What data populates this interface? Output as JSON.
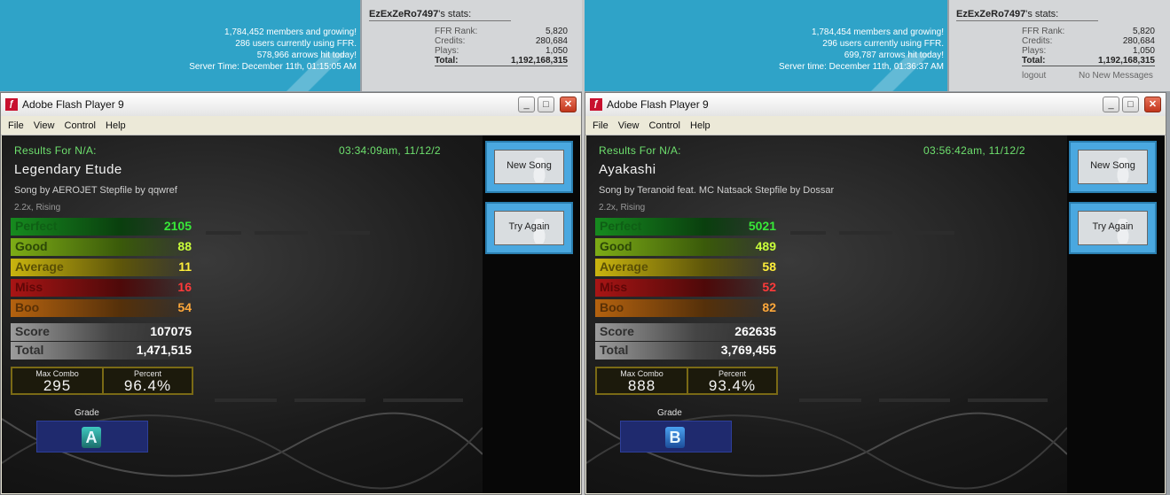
{
  "left": {
    "banner": {
      "lines": [
        "1,784,452 members and growing!",
        "286 users currently using FFR.",
        "578,966 arrows hit today!",
        "Server Time: December 11th, 01:15:05 AM"
      ]
    },
    "stats": {
      "user": "EzExZeRo7497",
      "suffix": "'s stats:",
      "rank_label": "FFR Rank:",
      "rank": "5,820",
      "credits_label": "Credits:",
      "credits": "280,684",
      "plays_label": "Plays:",
      "plays": "1,050",
      "total_label": "Total:",
      "total": "1,192,168,315"
    },
    "window": {
      "title": "Adobe Flash Player 9",
      "menu": [
        "File",
        "View",
        "Control",
        "Help"
      ]
    },
    "results": {
      "header": "Results For N/A:",
      "timestamp": "03:34:09am, 11/12/2",
      "song": "Legendary Etude",
      "byline": "Song by AEROJET   Stepfile by qqwref",
      "speed": "2.2x, Rising",
      "judgements": [
        {
          "label": "Perfect",
          "value": "2105"
        },
        {
          "label": "Good",
          "value": "88"
        },
        {
          "label": "Average",
          "value": "11"
        },
        {
          "label": "Miss",
          "value": "16"
        },
        {
          "label": "Boo",
          "value": "54"
        }
      ],
      "score_label": "Score",
      "score": "107075",
      "total_label": "Total",
      "total": "1,471,515",
      "max_combo_label": "Max Combo",
      "max_combo": "295",
      "percent_label": "Percent",
      "percent": "96.4%",
      "grade_label": "Grade",
      "grade": "A",
      "new_song": "New Song",
      "try_again": "Try Again"
    }
  },
  "right": {
    "banner": {
      "lines": [
        "1,784,454 members and growing!",
        "296 users currently using FFR.",
        "699,787 arrows hit today!",
        "Server time: December 11th, 01:36:37 AM"
      ]
    },
    "stats": {
      "user": "EzExZeRo7497",
      "suffix": "'s stats:",
      "rank_label": "FFR Rank:",
      "rank": "5,820",
      "credits_label": "Credits:",
      "credits": "280,684",
      "plays_label": "Plays:",
      "plays": "1,050",
      "total_label": "Total:",
      "total": "1,192,168,315",
      "logout": "logout",
      "messages": "No New Messages"
    },
    "window": {
      "title": "Adobe Flash Player 9",
      "menu": [
        "File",
        "View",
        "Control",
        "Help"
      ]
    },
    "results": {
      "header": "Results For N/A:",
      "timestamp": "03:56:42am, 11/12/2",
      "song": "Ayakashi",
      "byline": "Song by Teranoid feat. MC Natsack   Stepfile by Dossar",
      "speed": "2.2x, Rising",
      "judgements": [
        {
          "label": "Perfect",
          "value": "5021"
        },
        {
          "label": "Good",
          "value": "489"
        },
        {
          "label": "Average",
          "value": "58"
        },
        {
          "label": "Miss",
          "value": "52"
        },
        {
          "label": "Boo",
          "value": "82"
        }
      ],
      "score_label": "Score",
      "score": "262635",
      "total_label": "Total",
      "total": "3,769,455",
      "max_combo_label": "Max Combo",
      "max_combo": "888",
      "percent_label": "Percent",
      "percent": "93.4%",
      "grade_label": "Grade",
      "grade": "B",
      "new_song": "New Song",
      "try_again": "Try Again"
    }
  }
}
